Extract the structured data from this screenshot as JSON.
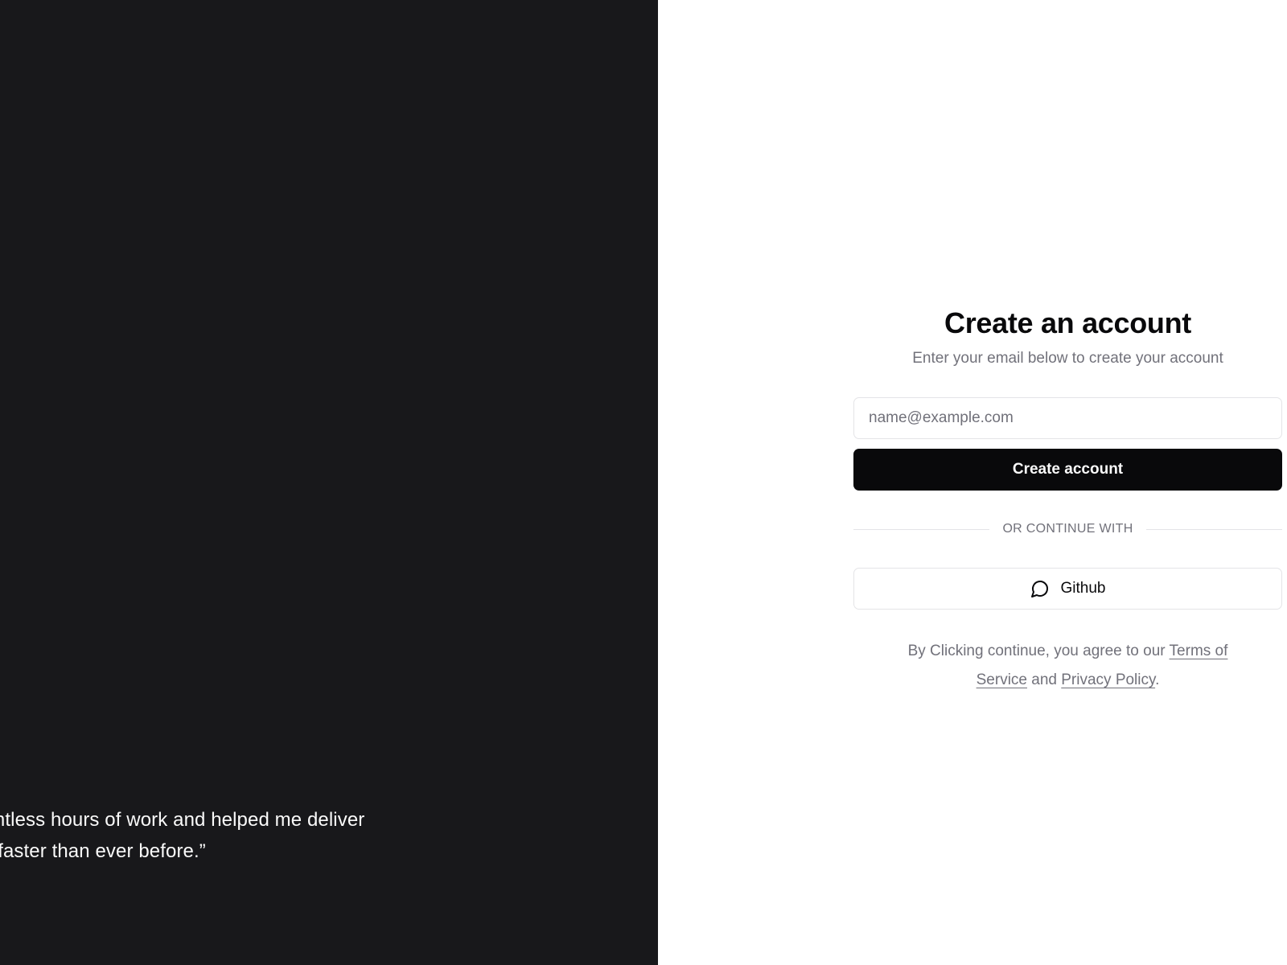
{
  "testimonial": {
    "quote": "as saved me countless hours of work and helped me deliver\ngns to my clients faster than ever before.”"
  },
  "signup": {
    "title": "Create an account",
    "subtitle": "Enter your email below to create your account",
    "email_placeholder": "name@example.com",
    "email_value": "",
    "submit_label": "Create account",
    "divider_label": "OR CONTINUE WITH",
    "github_label": "Github",
    "github_icon": "message-circle-icon"
  },
  "terms": {
    "prefix": "By Clicking continue, you agree to our ",
    "terms_link": "Terms of Service",
    "middle": " and ",
    "privacy_link": "Privacy Policy",
    "suffix": "."
  },
  "colors": {
    "left_panel_bg": "#18181b",
    "primary": "#09090b",
    "muted_text": "#71717a",
    "border": "#e4e4e7"
  }
}
